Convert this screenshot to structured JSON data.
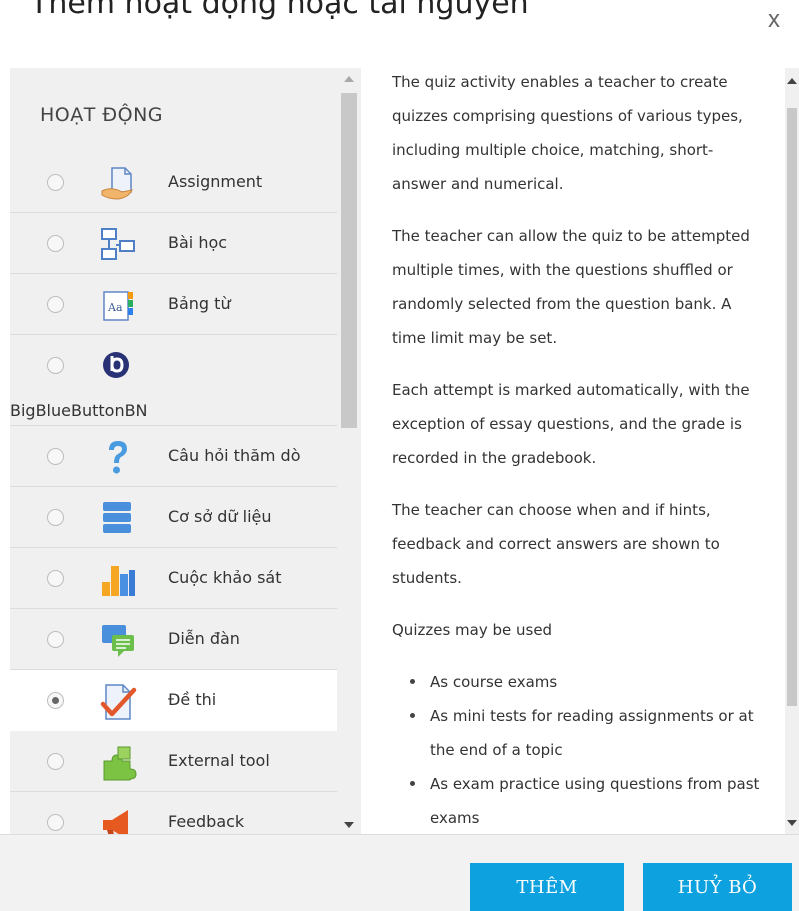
{
  "dialog": {
    "title": "Thêm hoạt động hoặc tài nguyên",
    "close_label": "x"
  },
  "activities": {
    "section_title": "HOẠT ĐỘNG",
    "items": [
      {
        "label": "Assignment",
        "icon": "assignment-icon",
        "selected": false
      },
      {
        "label": "Bài học",
        "icon": "lesson-icon",
        "selected": false
      },
      {
        "label": "Bảng từ",
        "icon": "glossary-icon",
        "selected": false
      },
      {
        "label": "BigBlueButtonBN",
        "icon": "bigbluebutton-icon",
        "selected": false
      },
      {
        "label": "Câu hỏi thăm dò",
        "icon": "choice-question-icon",
        "selected": false
      },
      {
        "label": "Cơ sở dữ liệu",
        "icon": "database-icon",
        "selected": false
      },
      {
        "label": "Cuộc khảo sát",
        "icon": "survey-chart-icon",
        "selected": false
      },
      {
        "label": "Diễn đàn",
        "icon": "forum-icon",
        "selected": false
      },
      {
        "label": "Đề thi",
        "icon": "quiz-icon",
        "selected": true
      },
      {
        "label": "External tool",
        "icon": "puzzle-icon",
        "selected": false
      },
      {
        "label": "Feedback",
        "icon": "megaphone-icon",
        "selected": false
      }
    ]
  },
  "description": {
    "paragraphs": [
      "The quiz activity enables a teacher to create quizzes comprising questions of various types, including multiple choice, matching, short-answer and numerical.",
      "The teacher can allow the quiz to be attempted multiple times, with the questions shuffled or randomly selected from the question bank. A time limit may be set.",
      "Each attempt is marked automatically, with the exception of essay questions, and the grade is recorded in the gradebook.",
      "The teacher can choose when and if hints, feedback and correct answers are shown to students.",
      "Quizzes may be used"
    ],
    "bullets": [
      "As course exams",
      "As mini tests for reading assignments or at the end of a topic",
      "As exam practice using questions from past exams"
    ]
  },
  "footer": {
    "add_label": "THÊM",
    "cancel_label": "HUỶ BỎ"
  },
  "colors": {
    "primary_button": "#0ea1df",
    "pane_background": "#f0f0f0"
  }
}
